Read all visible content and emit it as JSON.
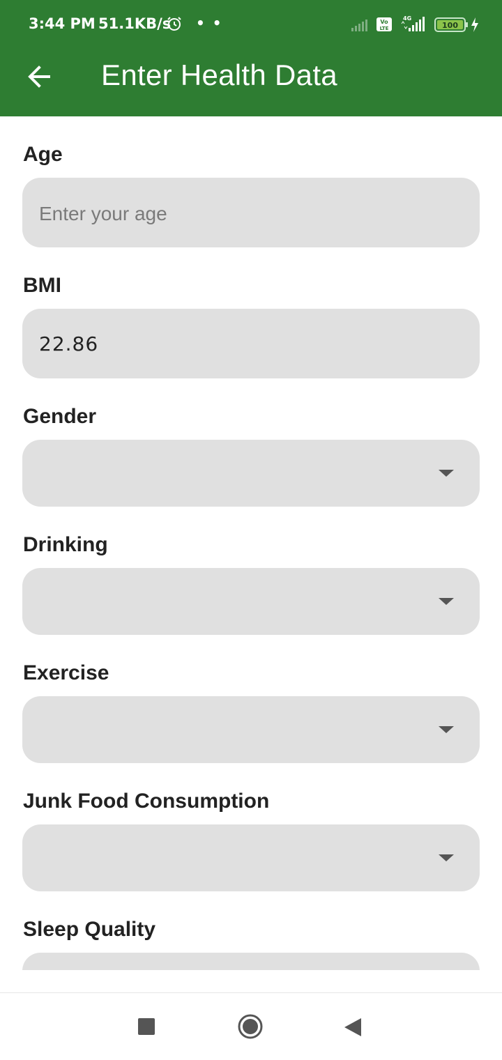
{
  "status_bar": {
    "time": "3:44 PM",
    "network_speed": "51.1KB/s",
    "alarm_icon": "alarm-clock-icon",
    "notification_dots": "• •",
    "volte_label": "Vo LTE",
    "network_type": "4G",
    "battery_level": "100",
    "charging_icon": "lightning-icon"
  },
  "app_bar": {
    "title": "Enter Health Data",
    "back_icon": "arrow-back-icon",
    "background_color": "#2e7d32"
  },
  "form": {
    "age": {
      "label": "Age",
      "placeholder": "Enter your age",
      "value": ""
    },
    "bmi": {
      "label": "BMI",
      "value": "22.86"
    },
    "gender": {
      "label": "Gender",
      "selected": ""
    },
    "drinking": {
      "label": "Drinking",
      "selected": ""
    },
    "exercise": {
      "label": "Exercise",
      "selected": ""
    },
    "junk_food": {
      "label": "Junk Food Consumption",
      "selected": ""
    },
    "sleep_quality": {
      "label": "Sleep Quality",
      "selected": ""
    }
  },
  "nav_bar": {
    "recents_icon": "square-icon",
    "home_icon": "circle-icon",
    "back_icon": "triangle-back-icon"
  }
}
